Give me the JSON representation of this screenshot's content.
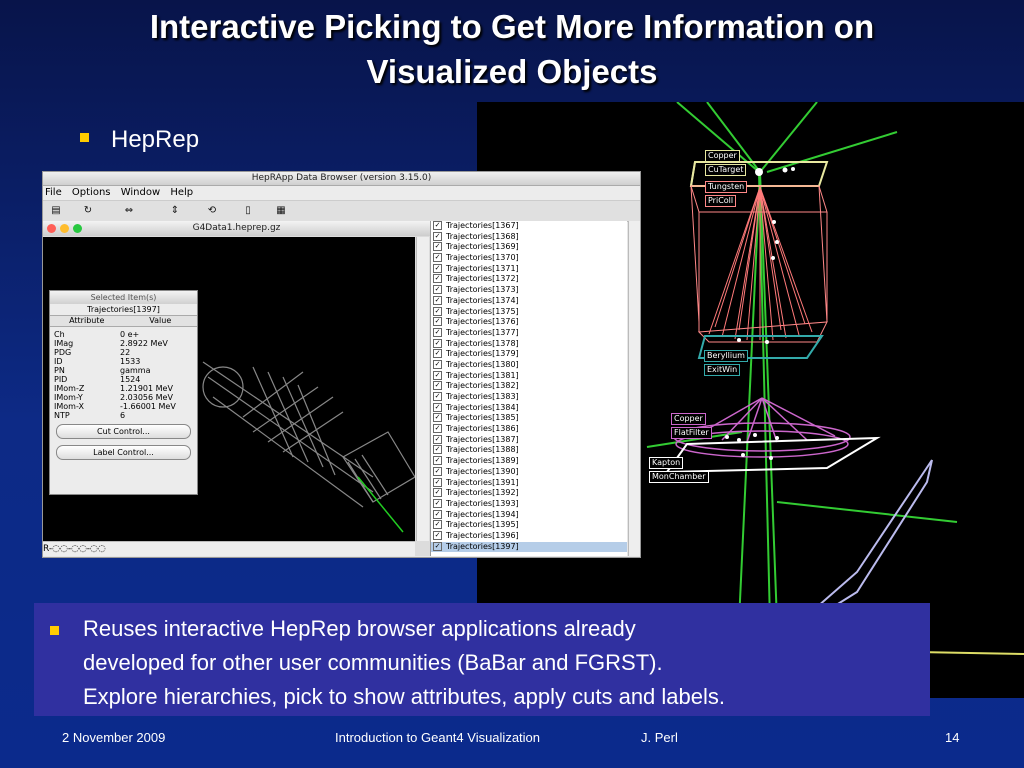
{
  "slide": {
    "title_line1": "Interactive Picking to Get More Information on",
    "title_line2": "Visualized Objects",
    "bullet_heprep": "HepRep",
    "bottom_line1": "Reuses interactive HepRep browser applications already",
    "bottom_line2": "developed for other user communities (BaBar and FGRST).",
    "bottom_line3": "Explore hierarchies, pick to show attributes, apply cuts and labels.",
    "footer_date": "2 November 2009",
    "footer_title": "Introduction to Geant4 Visualization",
    "footer_author": "J. Perl",
    "footer_page": "14"
  },
  "colors": {
    "accent": "#ffcc00",
    "box_bg": "#3030a0",
    "tree_selected": "#b5cde8"
  },
  "app": {
    "title": "HepRApp Data Browser (version 3.15.0)",
    "menu": [
      "File",
      "Options",
      "Window",
      "Help"
    ],
    "inner_title": "G4Data1.heprep.gz",
    "scroll_label": "R-◌◌-◌◌-◌◌",
    "selected": {
      "title": "Selected Item(s)",
      "subtitle": "Trajectories[1397]",
      "col_attribute": "Attribute",
      "col_value": "Value",
      "rows": [
        {
          "a": "Ch",
          "v": "0 e+"
        },
        {
          "a": "IMag",
          "v": "2.8922 MeV"
        },
        {
          "a": "PDG",
          "v": "22"
        },
        {
          "a": "ID",
          "v": "1533"
        },
        {
          "a": "PN",
          "v": "gamma"
        },
        {
          "a": "PID",
          "v": "1524"
        },
        {
          "a": "IMom-Z",
          "v": "1.21901 MeV"
        },
        {
          "a": "IMom-Y",
          "v": "2.03056 MeV"
        },
        {
          "a": "IMom-X",
          "v": "-1.66001 MeV"
        },
        {
          "a": "NTP",
          "v": "6"
        }
      ],
      "cut_button": "Cut Control...",
      "label_button": "Label Control..."
    },
    "tree_items": [
      "Trajectories[1367]",
      "Trajectories[1368]",
      "Trajectories[1369]",
      "Trajectories[1370]",
      "Trajectories[1371]",
      "Trajectories[1372]",
      "Trajectories[1373]",
      "Trajectories[1374]",
      "Trajectories[1375]",
      "Trajectories[1376]",
      "Trajectories[1377]",
      "Trajectories[1378]",
      "Trajectories[1379]",
      "Trajectories[1380]",
      "Trajectories[1381]",
      "Trajectories[1382]",
      "Trajectories[1383]",
      "Trajectories[1384]",
      "Trajectories[1385]",
      "Trajectories[1386]",
      "Trajectories[1387]",
      "Trajectories[1388]",
      "Trajectories[1389]",
      "Trajectories[1390]",
      "Trajectories[1391]",
      "Trajectories[1392]",
      "Trajectories[1393]",
      "Trajectories[1394]",
      "Trajectories[1395]",
      "Trajectories[1396]",
      "Trajectories[1397]"
    ],
    "tree_selected_item": "Trajectories[1397]"
  },
  "detector_labels": {
    "copper_top": "Copper",
    "cutarget": "CuTarget",
    "tungsten": "Tungsten",
    "pricoll": "PriColl",
    "beryllium": "Beryllium",
    "exitwin": "ExitWin",
    "copper_mid": "Copper",
    "flatfilter": "FlatFilter",
    "kapton": "Kapton",
    "monchamber": "MonChamber"
  }
}
